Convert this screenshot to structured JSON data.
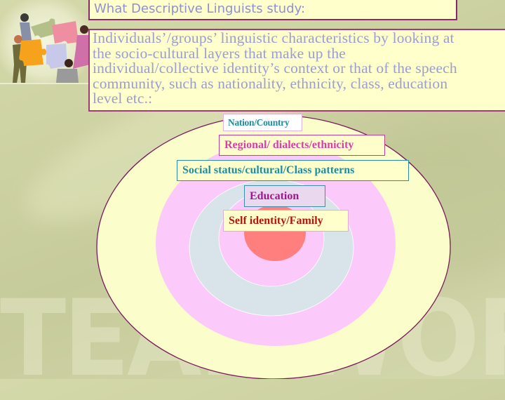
{
  "slide": {
    "title": "What Descriptive Linguists study:",
    "body": "Individuals’/groups’ linguistic characteristics by looking at\nthe socio-cultural layers that make up the\nindividual/collective identity’s context or that of the speech\ncommunity, such as nationality, ethnicity, class, education\nlevel etc.:",
    "watermark": "TEAMWORK",
    "clipart": "teamwork-puzzle-people-icon"
  },
  "diagram": {
    "type": "concentric-layers",
    "layers": [
      {
        "label": "Nation/Country",
        "fill": "#fbfdca",
        "label_text_color": "#1f8ea0"
      },
      {
        "label": "Regional/ dialects/ethnicity",
        "fill": "#fbcafb",
        "label_text_color": "#d83fa8"
      },
      {
        "label": "Social status/cultural/Class patterns",
        "fill": "#d8e4ea",
        "label_text_color": "#1f8e9e"
      },
      {
        "label": "Education",
        "fill": "#fbcafb",
        "label_text_color": "#a0168e"
      },
      {
        "label": "Self identity/Family",
        "fill": "#ff7f7f",
        "label_text_color": "#b8140c"
      }
    ]
  },
  "colors": {
    "title_text": "#8e90d0",
    "body_text": "#9b9dd0",
    "box_fill": "#ffffcc",
    "box_border": "#8a2a6a",
    "background": "#cdd2a2"
  }
}
